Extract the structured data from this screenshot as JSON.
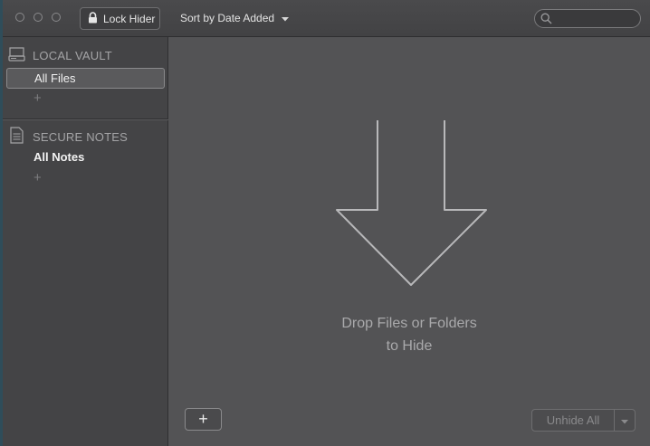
{
  "titlebar": {
    "lock_label": "Lock Hider",
    "sort_label": "Sort by Date Added",
    "search": {
      "placeholder": "",
      "value": ""
    }
  },
  "sidebar": {
    "local_vault": {
      "header": "LOCAL VAULT",
      "items": [
        {
          "label": "All Files",
          "selected": true
        }
      ],
      "add_symbol": "+"
    },
    "secure_notes": {
      "header": "SECURE NOTES",
      "items": [
        {
          "label": "All Notes",
          "selected": false
        }
      ],
      "add_symbol": "+"
    }
  },
  "main": {
    "drop_line1": "Drop Files or Folders",
    "drop_line2": "to Hide",
    "add_symbol": "+",
    "unhide_label": "Unhide All"
  },
  "colors": {
    "window_bg": "#505052",
    "sidebar_bg": "#444446",
    "main_bg": "#535355",
    "arrow_stroke": "#b8b8ba"
  },
  "icons": [
    "lock-icon",
    "chevron-down-icon",
    "search-icon",
    "drive-icon",
    "notes-icon",
    "drop-arrow-icon"
  ]
}
